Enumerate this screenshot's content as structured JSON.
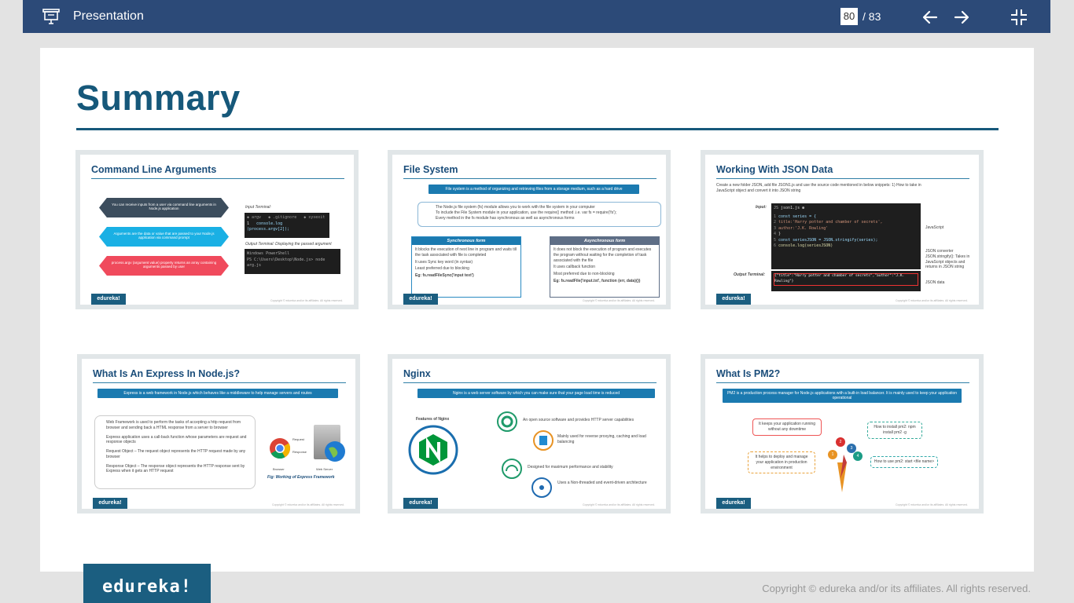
{
  "topbar": {
    "title": "Presentation",
    "current_page": "80",
    "total_pages": "/ 83"
  },
  "slide": {
    "title": "Summary",
    "cards": [
      {
        "title": "Command Line Arguments",
        "bullets": [
          "You can receive inputs from a user via command line arguments in Node.js application",
          "Arguments are the data or value that are passed to your Node.js application via command prompt",
          "process.argv (argument value) property returns an array containing arguments passed by user"
        ],
        "input_label": "Input Terminal:",
        "output_label": "Output Terminal: Displaying the passed argument",
        "code": "console.log (process.argv[2]);"
      },
      {
        "title": "File System",
        "banner": "File system is a method of organizing and retrieving files from a storage medium, such as a hard drive",
        "intro": [
          "The Node.js file system (fs) module allows you to work with the file system in your computer",
          "To include the File System module in your application, use the require() method .i.e. var fs = require('fs');",
          "Every method in the fs module has synchronous as well as asynchronous forms"
        ],
        "sync_title": "Synchronous form",
        "sync_items": [
          "It blocks the execution of next line in program and waits till the task associated with file is completed",
          "It uses Sync key word (in syntax)",
          "Least preferred due to blocking",
          "Eg: fs.readFileSync('input text')"
        ],
        "async_title": "Asynchronous form",
        "async_items": [
          "It does not block the execution of program and executes the program without waiting for the completion of task associated with the file",
          "It uses callback function",
          "Most preferred due to non-blocking",
          "Eg: fs.readFile('input.txt', function (err, data){})"
        ]
      },
      {
        "title": "Working With JSON Data",
        "intro": "Create a new folder JSON, add file JSON1.js and use the source code mentioned in below snippets: 1) How to take in JavaScript object and convert it into JSON string",
        "input_label": "Input:",
        "output_label": "Output Terminal:",
        "file": "json1.js",
        "code_lines": [
          "const series = {",
          "    title:'Harry potter and chamber of secrets',",
          "    author:'J.K. Rowling'",
          "}",
          "const seriesJSON = JSON.stringify(series);",
          "console.log(seriesJSON)"
        ],
        "output_line": "{\"title\":\"Harry potter and chamber of secrets\",\"author\":\"J.K. Rowling\"}",
        "note_js": "JavaScript",
        "note_converter": "JSON converter JSON.stringify(): Takes in JavaScript objects and returns in JSON string",
        "note_json": "JSON data"
      },
      {
        "title": "What Is An Express In Node.js?",
        "banner": "Express is a web framework in Node.js which behaves like a middleware to help manage servers and routes",
        "bullets": [
          "Web Framework is used to perform the tasks of accepting a http request from browser and sending back a HTML response from a server to browser",
          "Express application uses a call-back function whose parameters are request and response objects",
          "Request Object – The request object represents the HTTP request made by any browser",
          "Response Object – The response object represents the HTTP response sent by Express when it gets an HTTP request"
        ],
        "request": "Request",
        "response": "Response",
        "browser": "Browser",
        "server": "Web Server",
        "caption": "Fig: Working of Express Framework"
      },
      {
        "title": "Nginx",
        "banner": "Nginx is a web server software by which you can make sure that your page load time is reduced",
        "features_label": "Features of Nginx",
        "features": [
          "An open source software and provides HTTP server capabilities",
          "Mainly used for reverse proxying, caching and load balancing",
          "Designed for maximum performance and stability",
          "Uses a Non-threaded and event-driven architecture"
        ]
      },
      {
        "title": "What Is PM2?",
        "banner": "PM2 is a production process manager for Node.js applications with a built-in load balancer. It is mainly used to keep your application operational",
        "points": [
          "It keeps your application running without any downtime",
          "How to install pm2: npm install pm2 -g",
          "It helps to deploy and manage your application in production environment",
          "How to use pm2: start <file name>"
        ],
        "nums": [
          "1",
          "2",
          "3",
          "4"
        ]
      }
    ],
    "card_brand": "edureka!",
    "card_copy": "Copyright © edureka and/or its affiliates. All rights reserved."
  },
  "footer": {
    "brand": "edureka!",
    "copyright": "Copyright © edureka and/or its affiliates. All rights reserved."
  }
}
